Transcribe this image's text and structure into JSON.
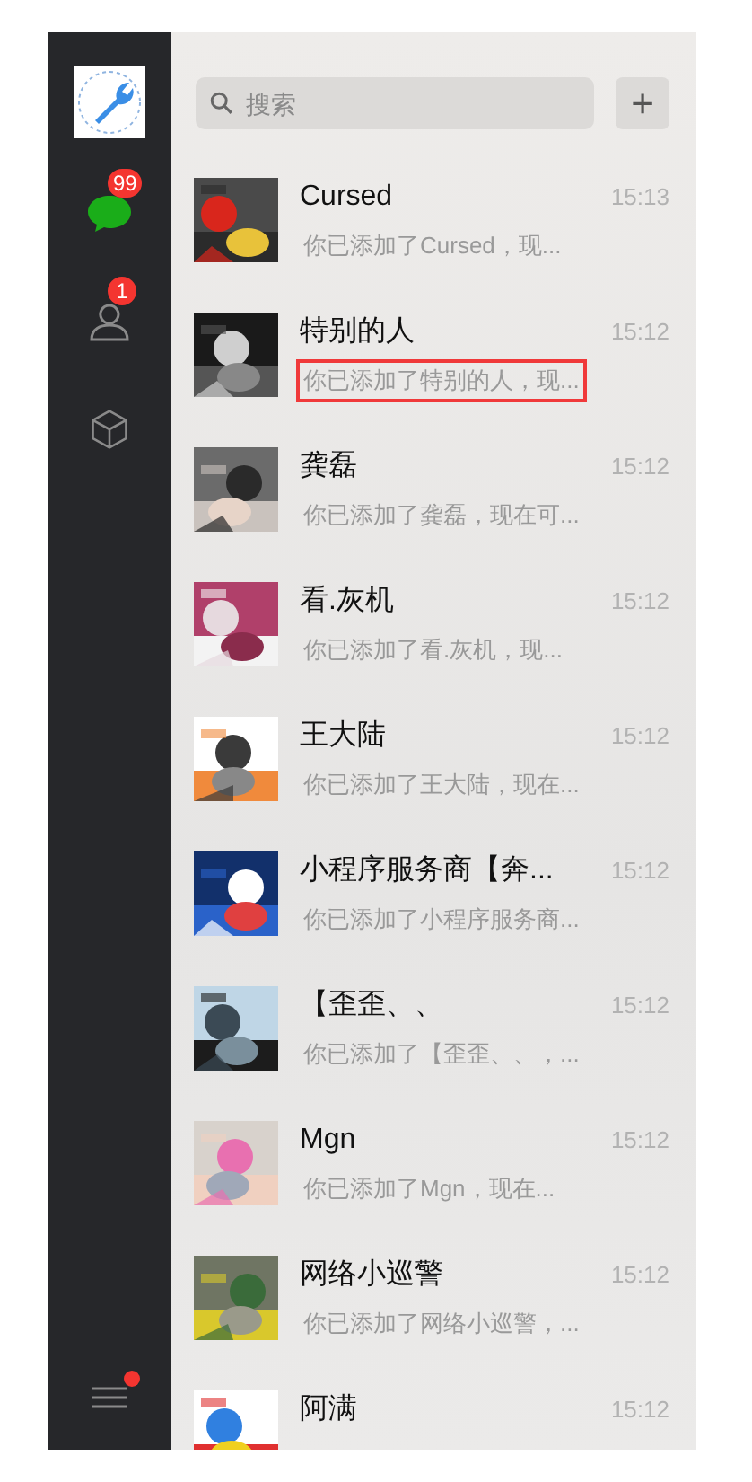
{
  "sidebar": {
    "items": [
      {
        "kind": "chats",
        "badge": "99",
        "selected": true
      },
      {
        "kind": "contacts",
        "badge": "1",
        "selected": false
      },
      {
        "kind": "apps",
        "selected": false
      }
    ],
    "menu": {
      "dot": true
    }
  },
  "search": {
    "placeholder": "搜索"
  },
  "add_button": {
    "label": "+"
  },
  "chats": [
    {
      "name": "Cursed",
      "time": "15:13",
      "preview": "你已添加了Cursed，现..."
    },
    {
      "name": "特别的人",
      "time": "15:12",
      "preview": "你已添加了特别的人，现...",
      "highlighted": true
    },
    {
      "name": "龚磊",
      "time": "15:12",
      "preview": "你已添加了龚磊，现在可..."
    },
    {
      "name": "看.灰机",
      "time": "15:12",
      "preview": "你已添加了看.灰机，现..."
    },
    {
      "name": "王大陆",
      "time": "15:12",
      "preview": "你已添加了王大陆，现在..."
    },
    {
      "name": "小程序服务商【奔...",
      "time": "15:12",
      "preview": "你已添加了小程序服务商..."
    },
    {
      "name": "【歪歪、、",
      "time": "15:12",
      "preview": "你已添加了【歪歪、、，..."
    },
    {
      "name": "Mgn",
      "time": "15:12",
      "preview": "你已添加了Mgn，现在..."
    },
    {
      "name": "网络小巡警",
      "time": "15:12",
      "preview": "你已添加了网络小巡警，..."
    },
    {
      "name": "阿满",
      "time": "15:12"
    }
  ]
}
